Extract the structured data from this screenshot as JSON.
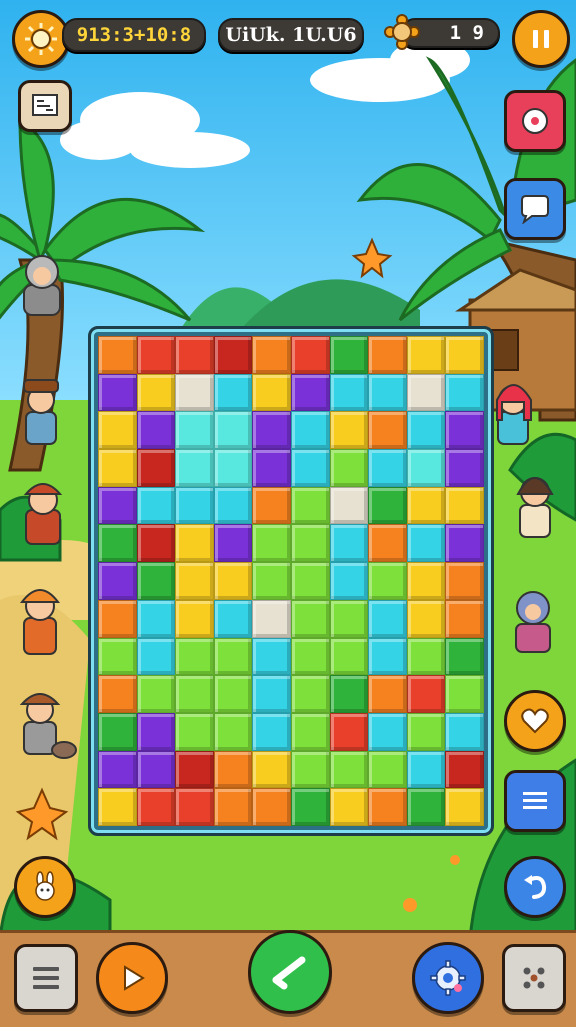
{
  "hud": {
    "score": "913:3+10:8",
    "title": "UiUk. 1U.U6",
    "lives": "1 9"
  },
  "icons": {
    "sun": "sun-coin-icon",
    "pause": "pause-icon",
    "menu": "menu-icon",
    "heart": "heart-icon",
    "play": "play-icon",
    "settings": "gear-icon",
    "dice": "dice-icon",
    "check": "check-icon",
    "bunny": "bunny-icon",
    "star": "star-icon",
    "undo": "undo-icon"
  },
  "colors": {
    "pause_button": "#f5a21b",
    "heart_button": "#f5a21b",
    "check_button": "#2fbf4a",
    "settings_button": "#2f6fe0",
    "list_button": "#3f7ee6",
    "undo_button": "#3a85e6"
  },
  "board": {
    "rows": 13,
    "cols": 10,
    "palette": {
      "R": "#e8402a",
      "O": "#f5821f",
      "Y": "#f8cd1f",
      "G": "#2fb33a",
      "L": "#7ee03a",
      "C": "#35d3e6",
      "T": "#58e8e0",
      "P": "#7a32d8",
      "W": "#e7e1d2",
      "D": "#c7271f"
    },
    "cells": [
      "ORRDORGOYY",
      "PYWCYPCCWC",
      "YPTTPCYOCP",
      "YDTTPCLCTP",
      "PCCCOLWGYY",
      "GDYPLLCOCP",
      "PGYYLLCLYO",
      "OCYCWLLCYO",
      "LCLLCLLCLG",
      "OLLLCLGORL",
      "GPLLCLRCLC",
      "PPDOYLLLCD",
      "YRROOGYOGY"
    ]
  }
}
